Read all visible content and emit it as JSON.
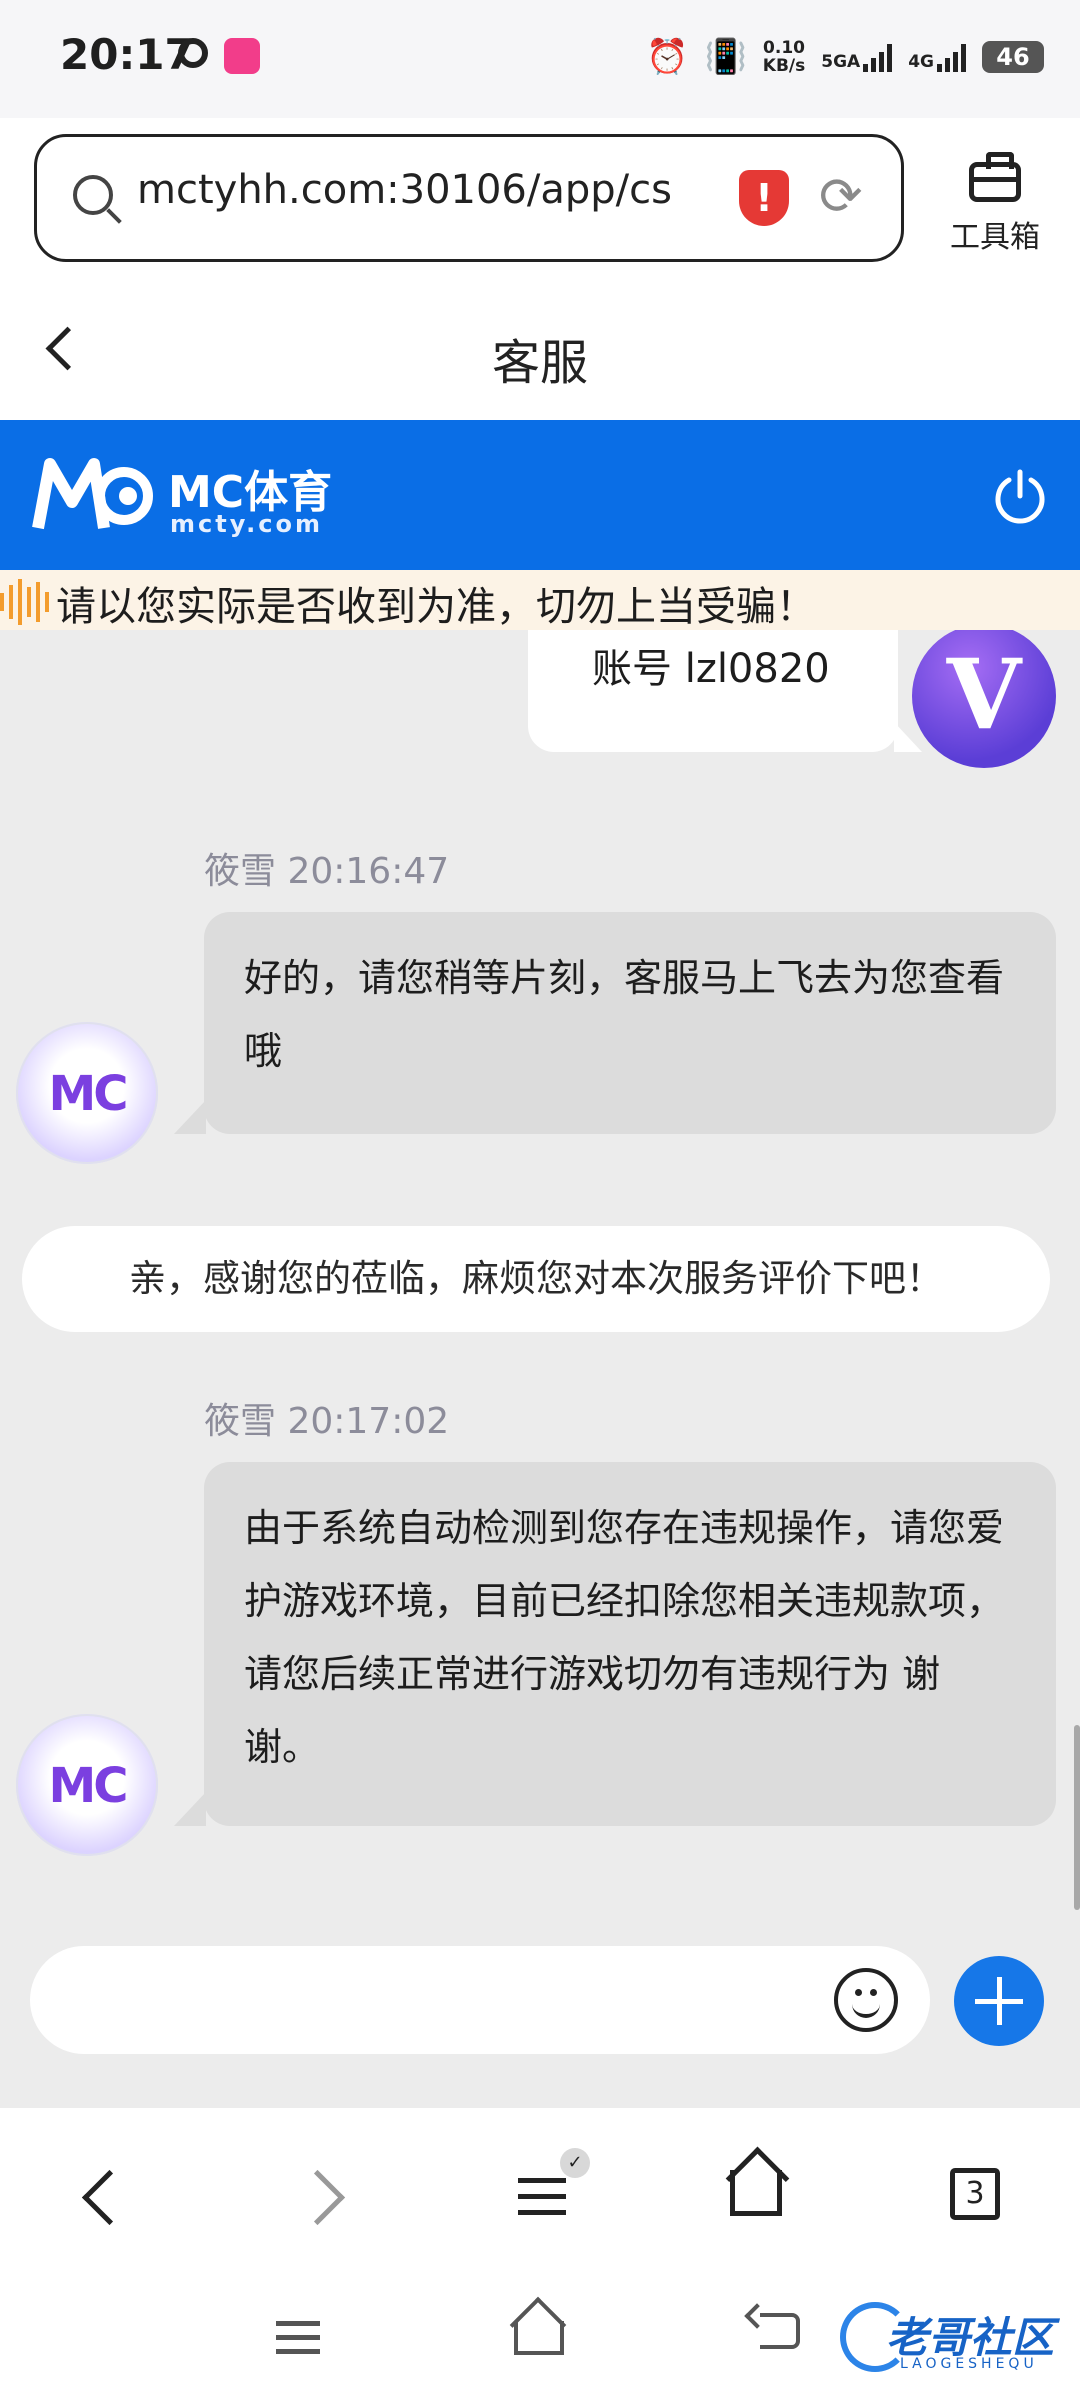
{
  "status_bar": {
    "time": "20:17",
    "net_speed_value": "0.10",
    "net_speed_unit": "KB/s",
    "network_1": "5GA",
    "network_2": "4G",
    "battery": "46",
    "icons": [
      "q-app-icon",
      "pink-app-icon",
      "alarm-icon",
      "vibrate-icon",
      "signal-icon",
      "battery-icon"
    ]
  },
  "browser": {
    "url": "mctyhh.com:30106/app/cs",
    "toolbox_label": "工具箱",
    "shield_mark": "!"
  },
  "page": {
    "title": "客服"
  },
  "brand": {
    "name": "MC体育",
    "url": "mcty.com",
    "color": "#0a6ee6"
  },
  "notice": {
    "text": "请以您实际是否收到为准，切勿上当受骗！"
  },
  "chat": {
    "user_message": "账号 lzl0820",
    "user_avatar_letter": "V",
    "agent_avatar_text": "MC",
    "messages": [
      {
        "sender": "筱雪",
        "time": "20:16:47",
        "text": "好的，请您稍等片刻，客服马上飞去为您查看哦"
      },
      {
        "sender": "筱雪",
        "time": "20:17:02",
        "text": "由于系统自动检测到您存在违规操作，请您爱护游戏环境，目前已经扣除您相关违规款项，请您后续正常进行游戏切勿有违规行为 谢谢。"
      }
    ],
    "system_note": "亲，感谢您的莅临，麻烦您对本次服务评价下吧！"
  },
  "composer": {
    "input_value": "",
    "placeholder": ""
  },
  "browser_nav": {
    "tabs_count": "3",
    "menu_badge": "✓"
  },
  "watermark": {
    "text": "老哥社区",
    "sub": "LAOGESHEQU"
  },
  "colors": {
    "accent_blue": "#1677e8",
    "shield_red": "#e53935",
    "agent_bubble": "#dcdcdc"
  }
}
